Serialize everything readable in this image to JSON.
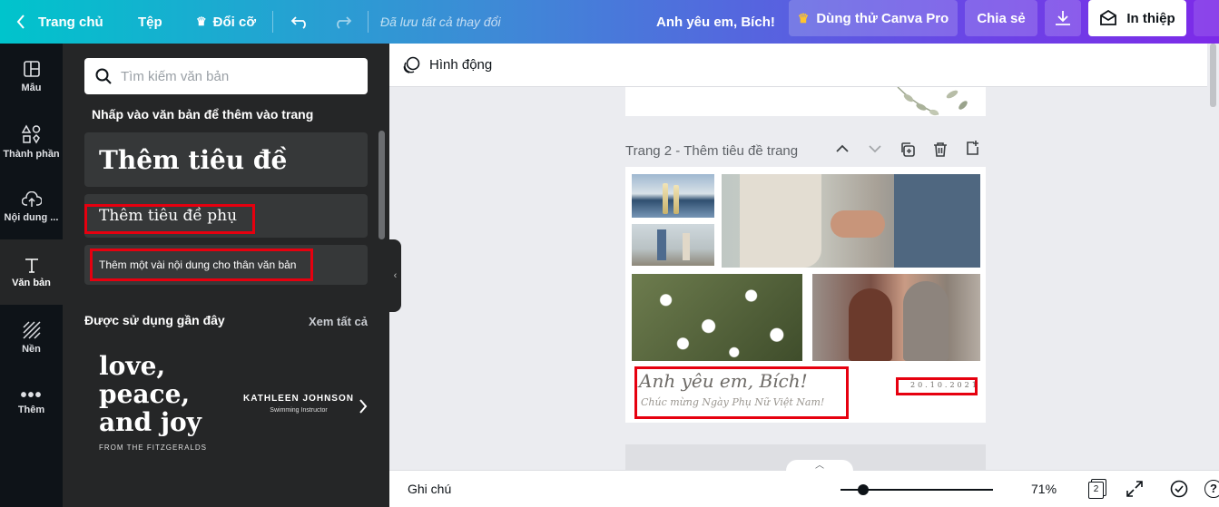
{
  "topbar": {
    "home": "Trang chủ",
    "file": "Tệp",
    "resize": "Đổi cỡ",
    "saved_status": "Đã lưu tất cả thay đổi",
    "design_title": "Anh yêu em, Bích!",
    "try_pro": "Dùng thử Canva Pro",
    "share": "Chia sẻ",
    "print": "In thiệp"
  },
  "rail": {
    "items": [
      {
        "label": "Mẫu",
        "icon": "layout-icon"
      },
      {
        "label": "Thành phần",
        "icon": "elements-icon"
      },
      {
        "label": "Nội dung ...",
        "icon": "upload-icon"
      },
      {
        "label": "Văn bản",
        "icon": "text-icon"
      },
      {
        "label": "Nền",
        "icon": "background-icon"
      },
      {
        "label": "Thêm",
        "icon": "more-icon"
      }
    ]
  },
  "panel": {
    "search_placeholder": "Tìm kiếm văn bản",
    "hint": "Nhấp vào văn bản để thêm vào trang",
    "add_heading": "Thêm tiêu đề",
    "add_subheading": "Thêm tiêu đề phụ",
    "add_body": "Thêm một vài nội dung cho thân văn bản",
    "recent_heading": "Được sử dụng gần đây",
    "see_all": "Xem tất cả",
    "recent_1": {
      "line1": "love,",
      "line2": "peace,",
      "line3": "and joy",
      "sub": "FROM THE FITZGERALDS"
    },
    "recent_2": {
      "name": "KATHLEEN JOHNSON",
      "role": "Swimming Instructor"
    }
  },
  "editor": {
    "animate": "Hình động",
    "page2_title": "Trang 2 - Thêm tiêu đề trang",
    "card_title": "Anh yêu em, Bích!",
    "card_subtitle": "Chúc mừng Ngày Phụ Nữ Việt Nam!",
    "card_date": "20.10.2021"
  },
  "bottombar": {
    "notes": "Ghi chú",
    "zoom": "71%",
    "page_count": "2",
    "zoom_fraction": 0.15
  },
  "colors": {
    "highlight": "#e6000f",
    "panel": "#252627",
    "rail": "#0e1318"
  }
}
